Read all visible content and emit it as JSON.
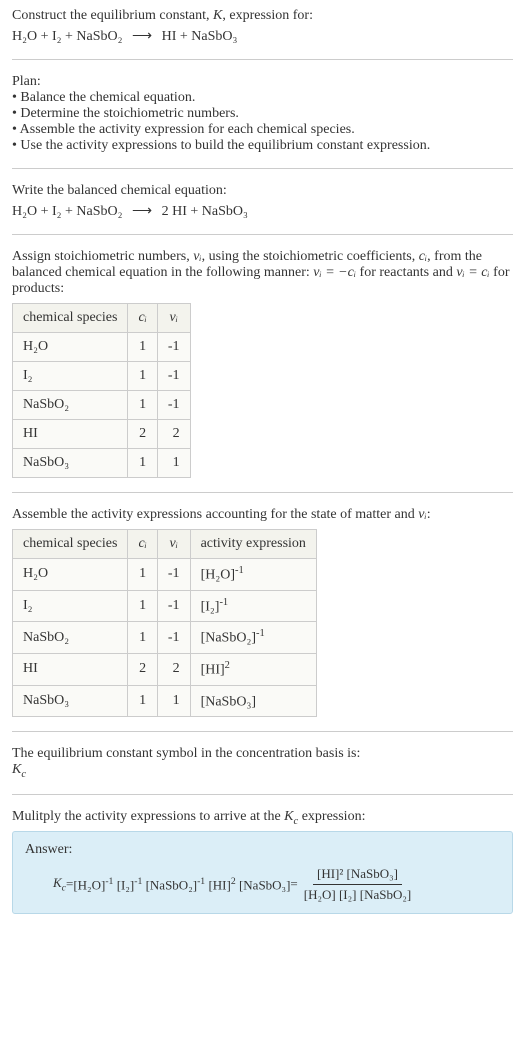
{
  "intro": {
    "line1_prefix": "Construct the equilibrium constant, ",
    "line1_K": "K",
    "line1_suffix": ", expression for:",
    "equation_lhs": "H₂O + I₂ + NaSbO₂",
    "equation_arrow": "⟶",
    "equation_rhs": "HI + NaSbO₃"
  },
  "plan": {
    "title": "Plan:",
    "items": [
      "Balance the chemical equation.",
      "Determine the stoichiometric numbers.",
      "Assemble the activity expression for each chemical species.",
      "Use the activity expressions to build the equilibrium constant expression."
    ]
  },
  "balanced": {
    "intro": "Write the balanced chemical equation:",
    "equation_lhs": "H₂O + I₂ + NaSbO₂",
    "equation_arrow": "⟶",
    "equation_rhs": "2 HI + NaSbO₃"
  },
  "stoich": {
    "intro_pre": "Assign stoichiometric numbers, ",
    "nu_i": "νᵢ",
    "intro_mid1": ", using the stoichiometric coefficients, ",
    "c_i": "cᵢ",
    "intro_mid2": ", from the balanced chemical equation in the following manner: ",
    "rel1": "νᵢ = −cᵢ",
    "intro_mid3": " for reactants and ",
    "rel2": "νᵢ = cᵢ",
    "intro_end": " for products:",
    "headers": {
      "species": "chemical species",
      "ci": "cᵢ",
      "nui": "νᵢ"
    },
    "rows": [
      {
        "species": "H₂O",
        "ci": "1",
        "nui": "-1"
      },
      {
        "species": "I₂",
        "ci": "1",
        "nui": "-1"
      },
      {
        "species": "NaSbO₂",
        "ci": "1",
        "nui": "-1"
      },
      {
        "species": "HI",
        "ci": "2",
        "nui": "2"
      },
      {
        "species": "NaSbO₃",
        "ci": "1",
        "nui": "1"
      }
    ]
  },
  "activity": {
    "intro_pre": "Assemble the activity expressions accounting for the state of matter and ",
    "nu_i": "νᵢ",
    "intro_suffix": ":",
    "headers": {
      "species": "chemical species",
      "ci": "cᵢ",
      "nui": "νᵢ",
      "expr": "activity expression"
    },
    "rows": [
      {
        "species": "H₂O",
        "ci": "1",
        "nui": "-1",
        "expr_base": "[H₂O]",
        "expr_exp": "-1"
      },
      {
        "species": "I₂",
        "ci": "1",
        "nui": "-1",
        "expr_base": "[I₂]",
        "expr_exp": "-1"
      },
      {
        "species": "NaSbO₂",
        "ci": "1",
        "nui": "-1",
        "expr_base": "[NaSbO₂]",
        "expr_exp": "-1"
      },
      {
        "species": "HI",
        "ci": "2",
        "nui": "2",
        "expr_base": "[HI]",
        "expr_exp": "2"
      },
      {
        "species": "NaSbO₃",
        "ci": "1",
        "nui": "1",
        "expr_base": "[NaSbO₃]",
        "expr_exp": ""
      }
    ]
  },
  "kc_symbol": {
    "intro": "The equilibrium constant symbol in the concentration basis is:",
    "symbol_K": "K",
    "symbol_sub": "c"
  },
  "multiply": {
    "intro_pre": "Mulitply the activity expressions to arrive at the ",
    "K": "K",
    "c": "c",
    "intro_suffix": " expression:"
  },
  "answer": {
    "label": "Answer:",
    "Kc_K": "K",
    "Kc_c": "c",
    "eq": " = ",
    "terms": [
      {
        "base": "[H₂O]",
        "exp": "-1"
      },
      {
        "base": "[I₂]",
        "exp": "-1"
      },
      {
        "base": "[NaSbO₂]",
        "exp": "-1"
      },
      {
        "base": "[HI]",
        "exp": "2"
      },
      {
        "base": "[NaSbO₃]",
        "exp": ""
      }
    ],
    "eq2": " = ",
    "frac_num": "[HI]² [NaSbO₃]",
    "frac_den": "[H₂O] [I₂] [NaSbO₂]"
  }
}
